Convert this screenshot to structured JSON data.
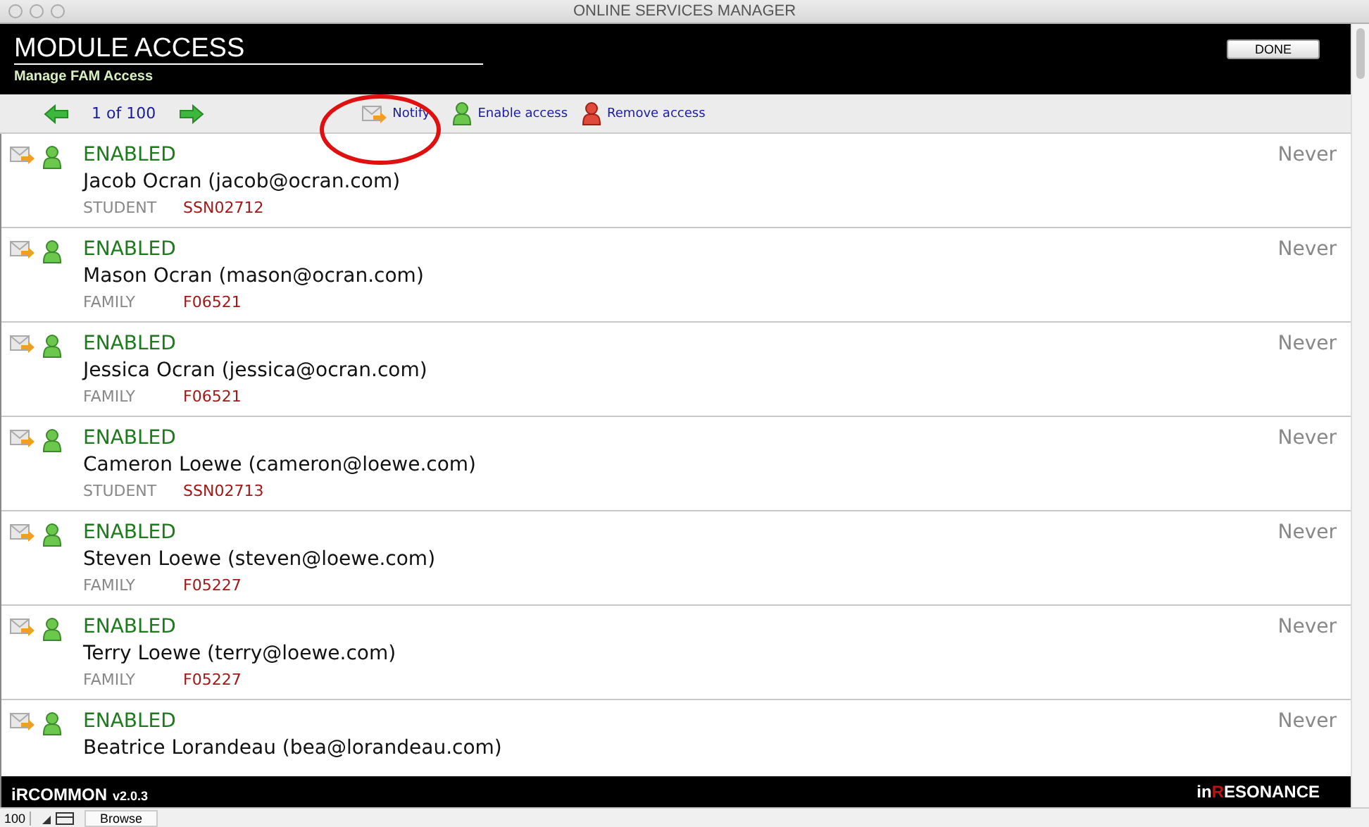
{
  "window": {
    "title": "ONLINE SERVICES MANAGER"
  },
  "header": {
    "title": "MODULE ACCESS",
    "subtitle": "Manage FAM Access",
    "done_button": "DONE"
  },
  "toolbar": {
    "pager": "1 of 100",
    "actions": [
      {
        "kind": "notify",
        "label": "Notify",
        "circled": true
      },
      {
        "kind": "enable",
        "label": "Enable access",
        "circled": false
      },
      {
        "kind": "remove",
        "label": "Remove access",
        "circled": false
      }
    ]
  },
  "rows": [
    {
      "status": "ENABLED",
      "name": "Jacob Ocran (jacob@ocran.com)",
      "type": "STUDENT",
      "id": "SSN02712",
      "last": "Never"
    },
    {
      "status": "ENABLED",
      "name": "Mason Ocran (mason@ocran.com)",
      "type": "FAMILY",
      "id": "F06521",
      "last": "Never"
    },
    {
      "status": "ENABLED",
      "name": "Jessica Ocran (jessica@ocran.com)",
      "type": "FAMILY",
      "id": "F06521",
      "last": "Never"
    },
    {
      "status": "ENABLED",
      "name": "Cameron Loewe (cameron@loewe.com)",
      "type": "STUDENT",
      "id": "SSN02713",
      "last": "Never"
    },
    {
      "status": "ENABLED",
      "name": "Steven Loewe (steven@loewe.com)",
      "type": "FAMILY",
      "id": "F05227",
      "last": "Never"
    },
    {
      "status": "ENABLED",
      "name": "Terry Loewe (terry@loewe.com)",
      "type": "FAMILY",
      "id": "F05227",
      "last": "Never"
    },
    {
      "status": "ENABLED",
      "name": "Beatrice Lorandeau (bea@lorandeau.com)",
      "last": "Never"
    }
  ],
  "footer": {
    "app": "iRCOMMON",
    "version": "v2.0.3",
    "logo_prefix": "in",
    "logo_accent": "R",
    "logo_rest": "ESONANCE"
  },
  "status_bar": {
    "zoom": "100",
    "mode": "Browse"
  }
}
